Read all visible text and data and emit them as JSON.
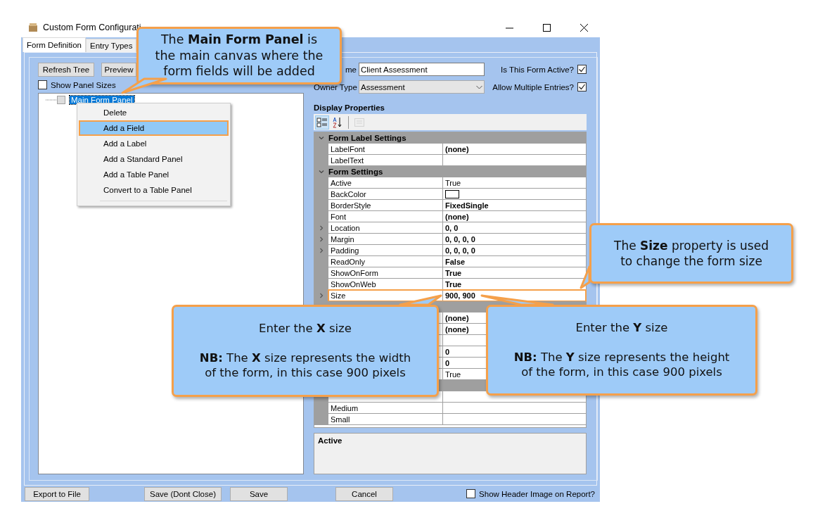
{
  "window": {
    "title": "Custom Form Configurati",
    "tabs": [
      {
        "label": "Form Definition",
        "selected": true
      },
      {
        "label": "Entry Types",
        "selected": false
      }
    ]
  },
  "left": {
    "buttons": [
      "Refresh Tree",
      "Preview"
    ],
    "show_panel_sizes": {
      "label": "Show Panel Sizes",
      "checked": false
    },
    "tree": [
      {
        "label": "Main Form Panel",
        "selected": true
      }
    ],
    "context_menu": [
      {
        "label": "Delete",
        "selected": false
      },
      {
        "label": "Add a Field",
        "selected": true
      },
      {
        "label": "Add a Label",
        "selected": false
      },
      {
        "label": "Add a Standard Panel",
        "selected": false
      },
      {
        "label": "Add a Table Panel",
        "selected": false
      },
      {
        "label": "Convert to a Table Panel",
        "selected": false
      }
    ]
  },
  "right": {
    "form_name": {
      "label": "me",
      "value": "Client Assessment"
    },
    "owner_type": {
      "label": "Owner Type",
      "value": "Assessment"
    },
    "options": [
      {
        "label": "Is This Form Active?",
        "checked": true
      },
      {
        "label": "Allow Multiple Entries?",
        "checked": true
      }
    ],
    "display_properties": {
      "title": "Display Properties",
      "toolbar": [
        {
          "kind": "categorized",
          "selected": true,
          "disabled": false
        },
        {
          "kind": "alphabetical",
          "selected": false,
          "disabled": false
        },
        {
          "kind": "pages",
          "selected": false,
          "disabled": true
        }
      ],
      "categories": [
        {
          "title": "Form Label Settings",
          "rows": [
            {
              "name": "LabelFont",
              "value": "(none)",
              "bold": true
            },
            {
              "name": "LabelText"
            }
          ]
        },
        {
          "title": "Form Settings",
          "rows": [
            {
              "name": "Active",
              "value": "True",
              "bold": false
            },
            {
              "name": "BackColor",
              "kind": "swatch"
            },
            {
              "name": "BorderStyle",
              "value": "FixedSingle",
              "bold": true
            },
            {
              "name": "Font",
              "value": "(none)",
              "bold": true
            },
            {
              "name": "Location",
              "value": "0, 0",
              "bold": true,
              "expandable": true
            },
            {
              "name": "Margin",
              "value": "0, 0, 0, 0",
              "bold": true,
              "expandable": true
            },
            {
              "name": "Padding",
              "value": "0, 0, 0, 0",
              "bold": true,
              "expandable": true
            },
            {
              "name": "ReadOnly",
              "value": "False",
              "bold": true
            },
            {
              "name": "ShowOnForm",
              "value": "True",
              "bold": true
            },
            {
              "name": "ShowOnWeb",
              "value": "True",
              "bold": true
            },
            {
              "name": "Size",
              "value": "900, 900",
              "bold": true,
              "expandable": true,
              "highlighted": true
            }
          ]
        },
        {
          "rows": [
            {
              "value": "(none)",
              "bold": true
            },
            {
              "value": "(none)",
              "bold": true
            },
            {},
            {
              "value": "0",
              "bold": true
            },
            {
              "value": "0",
              "bold": true
            },
            {
              "value": "True",
              "bold": false
            }
          ]
        },
        {
          "rows": [
            {},
            {
              "name": "Medium"
            },
            {
              "name": "Small"
            }
          ]
        }
      ],
      "description": "Active"
    }
  },
  "bottom": {
    "buttons": [
      "Export to File",
      "Save (Dont Close)",
      "Save",
      "Cancel"
    ],
    "show_header": {
      "label": "Show Header Image on Report?",
      "checked": false
    }
  },
  "callouts": [
    {
      "paragraphs": [
        "The **Main Form Panel** is the main canvas where the form fields will be added"
      ]
    },
    {
      "paragraphs": [
        "The **Size** property is used to change the form size"
      ]
    },
    {
      "paragraphs": [
        "Enter the **X** size",
        "**NB:** The **X** size represents the width of the form, in this case 900 pixels"
      ]
    },
    {
      "paragraphs": [
        "Enter the **Y** size",
        "**NB:** The **Y** size represents the height of the form, in this case 900 pixels"
      ]
    }
  ]
}
